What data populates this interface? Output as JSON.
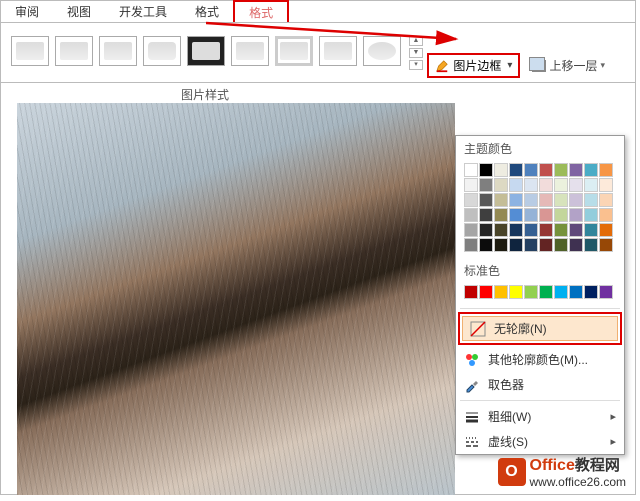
{
  "tabs": {
    "review": "审阅",
    "view": "视图",
    "dev": "开发工具",
    "format1": "格式",
    "format2": "格式"
  },
  "gallery_label": "图片样式",
  "border_button": {
    "label": "图片边框"
  },
  "bring_forward": "上移一层",
  "dropdown": {
    "theme_colors_label": "主题颜色",
    "standard_colors_label": "标准色",
    "no_outline": "无轮廓(N)",
    "more_colors": "其他轮廓颜色(M)...",
    "eyedropper": "取色器",
    "weight": "粗细(W)",
    "dashes": "虚线(S)"
  },
  "theme_colors_row0": [
    "#ffffff",
    "#000000",
    "#eeece1",
    "#1f497d",
    "#4f81bd",
    "#c0504d",
    "#9bbb59",
    "#8064a2",
    "#4bacc6",
    "#f79646"
  ],
  "theme_colors_rows": [
    [
      "#f2f2f2",
      "#7f7f7f",
      "#ddd9c3",
      "#c6d9f0",
      "#dbe5f1",
      "#f2dcdb",
      "#ebf1dd",
      "#e5e0ec",
      "#dbeef3",
      "#fdeada"
    ],
    [
      "#d8d8d8",
      "#595959",
      "#c4bd97",
      "#8db3e2",
      "#b8cce4",
      "#e5b9b7",
      "#d7e3bc",
      "#ccc1d9",
      "#b7dde8",
      "#fbd5b5"
    ],
    [
      "#bfbfbf",
      "#3f3f3f",
      "#938953",
      "#548dd4",
      "#95b3d7",
      "#d99694",
      "#c3d69b",
      "#b2a2c7",
      "#92cddc",
      "#fac08f"
    ],
    [
      "#a5a5a5",
      "#262626",
      "#494429",
      "#17365d",
      "#366092",
      "#953734",
      "#76923c",
      "#5f497a",
      "#31859b",
      "#e36c09"
    ],
    [
      "#7f7f7f",
      "#0c0c0c",
      "#1d1b10",
      "#0f243e",
      "#244061",
      "#632423",
      "#4f6128",
      "#3f3151",
      "#205867",
      "#974806"
    ]
  ],
  "standard_colors": [
    "#c00000",
    "#ff0000",
    "#ffc000",
    "#ffff00",
    "#92d050",
    "#00b050",
    "#00b0f0",
    "#0070c0",
    "#002060",
    "#7030a0"
  ],
  "watermark": {
    "brand": "Office",
    "brand_cn": "教程网",
    "url": "www.office26.com"
  }
}
